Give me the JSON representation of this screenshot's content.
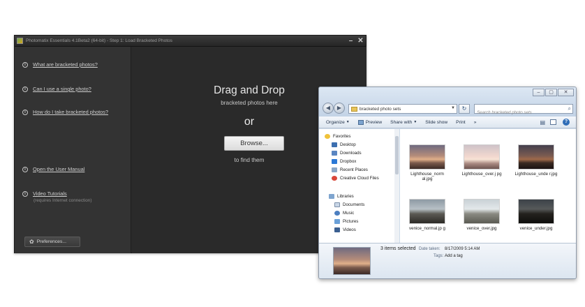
{
  "photomatix": {
    "title": "Photomatix Essentials 4.1Beta2 (64-bit) - Step 1: Load Bracketed Photos",
    "links": [
      {
        "label": "What are bracketed photos?"
      },
      {
        "label": "Can I use a single photo?"
      },
      {
        "label": "How do I take bracketed photos?"
      },
      {
        "label": "Open the User Manual"
      },
      {
        "label": "Video Tutorials",
        "sub": "(requires Internet connection)"
      }
    ],
    "preferences_label": "Preferences...",
    "drop": {
      "title": "Drag and Drop",
      "subtitle": "bracketed photos here",
      "or": "or",
      "browse_label": "Browse...",
      "find": "to find them"
    }
  },
  "explorer": {
    "address": "bracketed photo sets",
    "search_placeholder": "Search bracketed photo sets",
    "toolbar": [
      "Organize",
      "Preview",
      "Share with",
      "Slide show",
      "Print",
      "»"
    ],
    "favorites_label": "Favorites",
    "favorites": [
      "Desktop",
      "Downloads",
      "Dropbox",
      "Recent Places",
      "Creative Cloud Files"
    ],
    "libraries_label": "Libraries",
    "libraries": [
      "Documents",
      "Music",
      "Pictures",
      "Videos"
    ],
    "files": [
      {
        "name": "Lighthouse_norm al.jpg"
      },
      {
        "name": "Lighthouse_over.j pg"
      },
      {
        "name": "Lighthouse_unde r.jpg"
      },
      {
        "name": "venice_normal.jp g"
      },
      {
        "name": "venice_over.jpg"
      },
      {
        "name": "venice_under.jpg"
      }
    ],
    "details": {
      "count": "3 items selected",
      "date_label": "Date taken:",
      "date_value": "8/17/2009 5:14 AM",
      "tags_label": "Tags:",
      "tags_value": "Add a tag"
    }
  },
  "colors": {
    "photomatix_bg": "#2a2a2a",
    "sidebar_bg": "#333333",
    "explorer_frame": "#cfdcea"
  }
}
